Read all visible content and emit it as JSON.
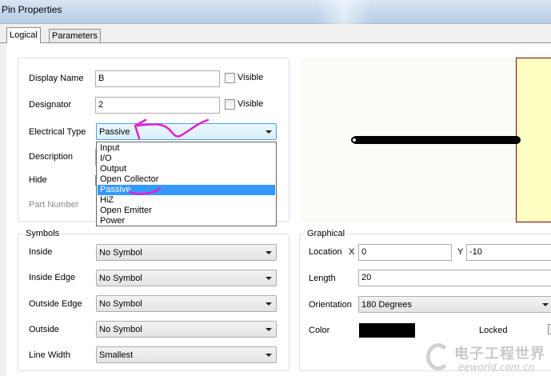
{
  "window": {
    "title": "Pin Properties"
  },
  "tabs": [
    {
      "label": "Logical",
      "active": true
    },
    {
      "label": "Parameters",
      "active": false
    }
  ],
  "logical": {
    "display_name": {
      "label": "Display Name",
      "value": "B",
      "visible_label": "Visible",
      "visible_checked": false
    },
    "designator": {
      "label": "Designator",
      "value": "2",
      "visible_label": "Visible",
      "visible_checked": false
    },
    "electrical_type": {
      "label": "Electrical Type",
      "value": "Passive",
      "options": [
        "Input",
        "I/O",
        "Output",
        "Open Collector",
        "Passive",
        "HiZ",
        "Open Emitter",
        "Power"
      ],
      "highlighted_index": 4
    },
    "description": {
      "label": "Description"
    },
    "hide": {
      "label": "Hide"
    },
    "part_number": {
      "label": "Part Number"
    }
  },
  "symbols": {
    "title": "Symbols",
    "inside": {
      "label": "Inside",
      "value": "No Symbol"
    },
    "inside_edge": {
      "label": "Inside Edge",
      "value": "No Symbol"
    },
    "outside_edge": {
      "label": "Outside Edge",
      "value": "No Symbol"
    },
    "outside": {
      "label": "Outside",
      "value": "No Symbol"
    },
    "line_width": {
      "label": "Line Width",
      "value": "Smallest"
    }
  },
  "graphical": {
    "title": "Graphical",
    "location": {
      "label": "Location",
      "x_label": "X",
      "x_value": "0",
      "y_label": "Y",
      "y_value": "-10"
    },
    "length": {
      "label": "Length",
      "value": "20"
    },
    "orientation": {
      "label": "Orientation",
      "value": "180 Degrees"
    },
    "color": {
      "label": "Color",
      "value": "#000000"
    },
    "locked": {
      "label": "Locked",
      "checked": false
    }
  },
  "watermark": {
    "line1": "电子工程世界",
    "line2": "eeworld.com.cn"
  },
  "colors": {
    "annotation": "#e020d0",
    "selection": "#3399ff",
    "pin": "#000000",
    "part_body": "#ffffc0"
  }
}
